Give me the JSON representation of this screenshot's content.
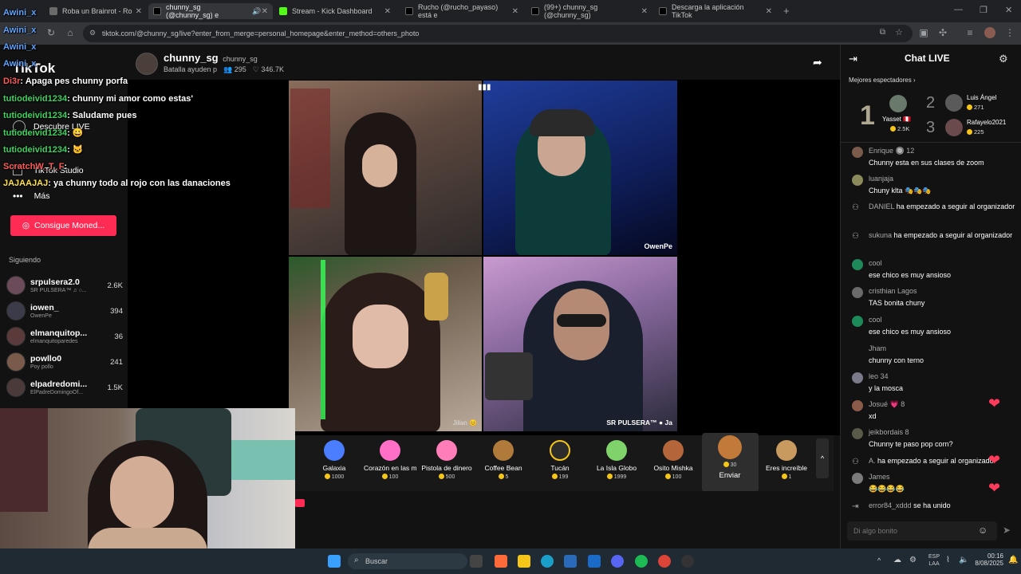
{
  "browser": {
    "tabs": [
      {
        "label": "Roba un Brainrot - Ro",
        "color": "#6a6a6a"
      },
      {
        "label": "chunny_sg (@chunny_sg) e",
        "color": "#111111"
      },
      {
        "label": "Stream - Kick Dashboard",
        "color": "#53fc18"
      },
      {
        "label": "Rucho (@rucho_payaso) está e",
        "color": "#111111"
      },
      {
        "label": "(99+) chunny_sg (@chunny_sg)",
        "color": "#111111"
      },
      {
        "label": "Descarga la aplicación TikTok",
        "color": "#111111"
      }
    ],
    "url": "tiktok.com/@chunny_sg/live?enter_from_merge=personal_homepage&enter_method=others_photo"
  },
  "sidebar": {
    "logo": "TikTok",
    "menu": [
      {
        "label": "Descubre LIVE"
      },
      {
        "label": "TikTok Studio"
      },
      {
        "label": "Más"
      }
    ],
    "coins_button": "Consigue Moned...",
    "following_title": "Siguiendo",
    "following": [
      {
        "name": "srpulsera2.0",
        "sub": "SR PULSERA™ ♫ ○...",
        "count": "2.6K"
      },
      {
        "name": "iowen_",
        "sub": "OwenPe",
        "count": "394"
      },
      {
        "name": "elmanquitop...",
        "sub": "elmanquitoparedes",
        "count": "36"
      },
      {
        "name": "powllo0",
        "sub": "Poy pollo",
        "count": "241"
      },
      {
        "name": "elpadredomi...",
        "sub": "ElPadreDomingoOf...",
        "count": "1.5K"
      }
    ]
  },
  "overlay_chat": [
    {
      "user": "Awini_x",
      "text": ""
    },
    {
      "user": "Awini_x",
      "text": ""
    },
    {
      "user": "Awini_x",
      "text": ""
    },
    {
      "user": "Awini_x",
      "text": ""
    },
    {
      "user": "Di3r",
      "text": ": Apaga pes chunny porfa"
    },
    {
      "user": "tutiodeivid1234",
      "text": ": chunny mi amor como estas'"
    },
    {
      "user": "tutiodeivid1234",
      "text": ": Saludame pues"
    },
    {
      "user": "tutiodeivid1234",
      "text": ": 😀"
    },
    {
      "user": "tutiodeivid1234",
      "text": ": 🐱"
    },
    {
      "user": "ScratchW_T_F",
      "text": ":"
    },
    {
      "user": "JAJAAJAJ",
      "text": ": ya chunny todo al rojo con las danaciones"
    }
  ],
  "stream": {
    "host_name": "chunny_sg",
    "host_handle": "chunny_sg",
    "host_sub": "Batalla ayuden p",
    "viewers": "295",
    "likes": "346.7K",
    "cam_labels": [
      "",
      "OwenPe",
      "Jilian 😊",
      "SR PULSERA™ ● Ja"
    ]
  },
  "gifts": [
    {
      "name": "Galaxia",
      "price": "1000",
      "color": "#4a7dff"
    },
    {
      "name": "Corazón en las m...",
      "price": "100",
      "color": "#ff6ec7"
    },
    {
      "name": "Pistola de dinero",
      "price": "500",
      "color": "#ff7eb9"
    },
    {
      "name": "Coffee Bean",
      "price": "5",
      "color": "#b07a3a"
    },
    {
      "name": "Tucán",
      "price": "199",
      "color": "#2c2c2c"
    },
    {
      "name": "La Isla Globo",
      "price": "1999",
      "color": "#7fd36a"
    },
    {
      "name": "Osito Mishka",
      "price": "100",
      "color": "#b5653a"
    },
    {
      "name": "Enviar",
      "price": "30",
      "color": "#c27a3a"
    },
    {
      "name": "Eres increíble",
      "price": "1",
      "color": "#c99a60"
    }
  ],
  "chat": {
    "title": "Chat LIVE",
    "top_viewers_label": "Mejores espectadores",
    "top": [
      {
        "rank": "1",
        "name": "Yasset 🇵🇪",
        "score": "2.5K"
      },
      {
        "rank": "2",
        "name": "Luis Ángel",
        "score": "271"
      },
      {
        "rank": "3",
        "name": "Rafayelo2021",
        "score": "225"
      }
    ],
    "messages": [
      {
        "user": "Enrique 🔘 12",
        "text": "Chunny esta en sus clases de zoom"
      },
      {
        "user": "luanjaja",
        "text": "Chuny klta 🎭🎭🎭"
      },
      {
        "user": "DANIEL",
        "text": "ha empezado a seguir al organizador"
      },
      {
        "user": "sukuna",
        "text": "ha empezado a seguir al organizador"
      },
      {
        "user": "cool",
        "text": "ese chico es muy ansioso"
      },
      {
        "user": "cristhian Lagos",
        "text": "TAS bonita chuny"
      },
      {
        "user": "cool",
        "text": "ese chico es muy ansioso"
      },
      {
        "user": "Jham",
        "text": "chunny con terno"
      },
      {
        "user": "leo 34",
        "text": "y la mosca"
      },
      {
        "user": "Josué 💗 8",
        "text": "xd"
      },
      {
        "user": "jeikbordais 8",
        "text": "Chunny te paso pop corn?"
      },
      {
        "user": "A.",
        "text": "ha empezado a seguir al organizador"
      },
      {
        "user": "James",
        "text": "😂😂😂😂"
      },
      {
        "user": "error84_xddd",
        "text": "se ha unido"
      }
    ],
    "input_placeholder": "Di algo bonito"
  },
  "taskbar": {
    "search": "Buscar",
    "lang": "ESP\nLAA",
    "time": "00:16",
    "date": "8/08/2025"
  }
}
